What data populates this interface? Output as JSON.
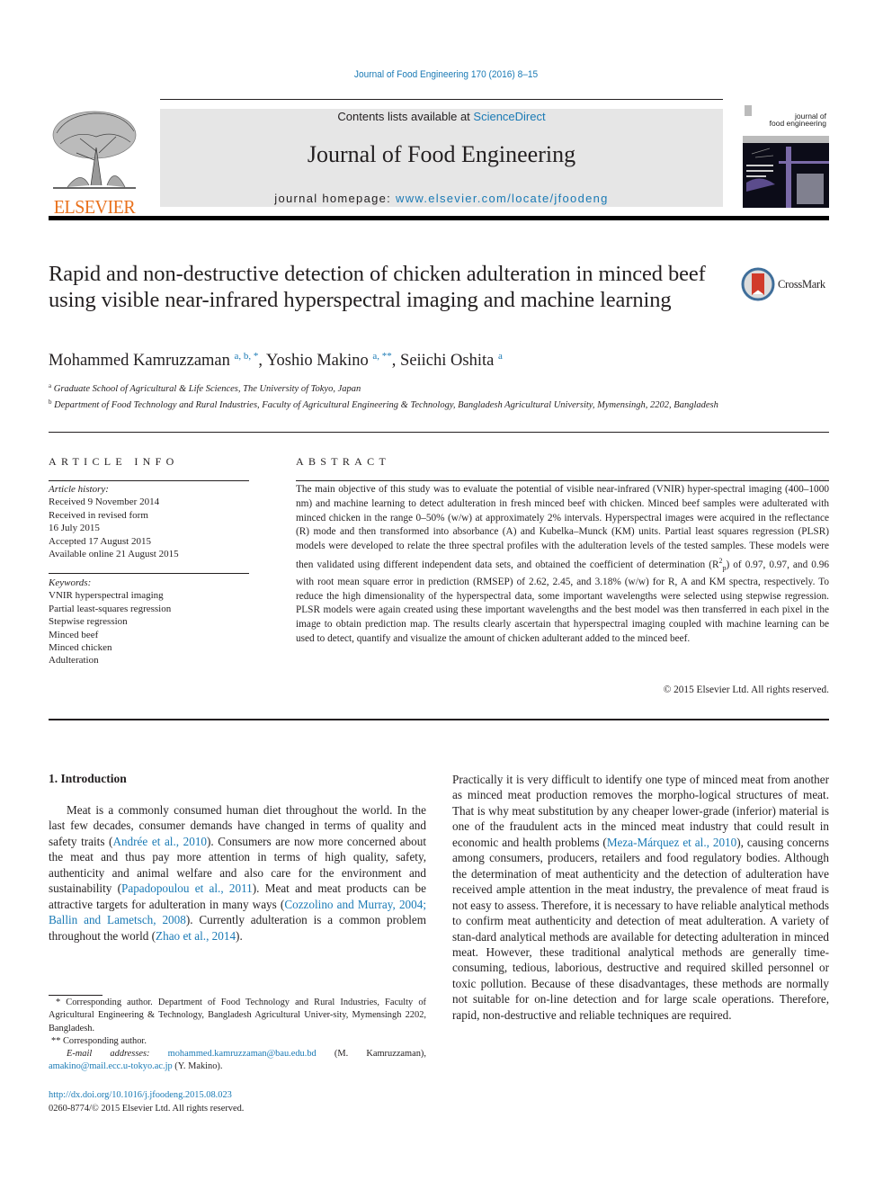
{
  "running_header": "Journal of Food Engineering 170 (2016) 8–15",
  "masthead": {
    "publisher": "ELSEVIER",
    "contents_prefix": "Contents lists available at ",
    "contents_link": "ScienceDirect",
    "journal_title": "Journal of Food Engineering",
    "homepage_prefix": "journal homepage: ",
    "homepage_link": "www.elsevier.com/locate/jfoodeng",
    "cover_title_line1": "journal of",
    "cover_title_line2": "food engineering"
  },
  "article": {
    "title": "Rapid and non-destructive detection of chicken adulteration in minced beef using visible near-infrared hyperspectral imaging and machine learning",
    "crossmark_label": "CrossMark",
    "authors": [
      {
        "name": "Mohammed Kamruzzaman",
        "sup": "a, b, *",
        "sep": ", "
      },
      {
        "name": "Yoshio Makino",
        "sup": "a, **",
        "sep": ", "
      },
      {
        "name": "Seiichi Oshita",
        "sup": "a",
        "sep": ""
      }
    ],
    "affiliations": [
      {
        "key": "a",
        "text": "Graduate School of Agricultural & Life Sciences, The University of Tokyo, Japan"
      },
      {
        "key": "b",
        "text": "Department of Food Technology and Rural Industries, Faculty of Agricultural Engineering & Technology, Bangladesh Agricultural University, Mymensingh, 2202, Bangladesh"
      }
    ]
  },
  "article_info": {
    "heading": "ARTICLE INFO",
    "history_label": "Article history:",
    "history": [
      "Received 9 November 2014",
      "Received in revised form",
      "16 July 2015",
      "Accepted 17 August 2015",
      "Available online 21 August 2015"
    ],
    "keywords_label": "Keywords:",
    "keywords": [
      "VNIR hyperspectral imaging",
      "Partial least-squares regression",
      "Stepwise regression",
      "Minced beef",
      "Minced chicken",
      "Adulteration"
    ]
  },
  "abstract": {
    "heading": "ABSTRACT",
    "text_part1": "The main objective of this study was to evaluate the potential of visible near-infrared (VNIR) hyper-spectral imaging (400–1000 nm) and machine learning to detect adulteration in fresh minced beef with chicken. Minced beef samples were adulterated with minced chicken in the range 0–50% (w/w) at approximately 2% intervals. Hyperspectral images were acquired in the reflectance (R) mode and then transformed into absorbance (A) and Kubelka–Munck (KM) units. Partial least squares regression (PLSR) models were developed to relate the three spectral profiles with the adulteration levels of the tested samples. These models were then validated using different independent data sets, and obtained the coefficient of determination (R",
    "sup": "2",
    "sub": "p",
    "text_part2": ") of 0.97, 0.97, and 0.96 with root mean square error in prediction (RMSEP) of 2.62, 2.45, and 3.18% (w/w) for R, A and KM spectra, respectively. To reduce the high dimensionality of the hyperspectral data, some important wavelengths were selected using stepwise regression. PLSR models were again created using these important wavelengths and the best model was then transferred in each pixel in the image to obtain prediction map. The results clearly ascertain that hyperspectral imaging coupled with machine learning can be used to detect, quantify and visualize the amount of chicken adulterant added to the minced beef.",
    "copyright": "© 2015 Elsevier Ltd. All rights reserved."
  },
  "body": {
    "section_heading": "1.  Introduction",
    "left_paragraph": [
      {
        "t": "Meat is a commonly consumed human diet throughout the world. In the last few decades, consumer demands have changed in terms of quality and safety traits ("
      },
      {
        "link": "Andrée et al., 2010"
      },
      {
        "t": "). Consumers are now more concerned about the meat and thus pay more attention in terms of high quality, safety, authenticity and animal welfare and also care for the environment and sustainability ("
      },
      {
        "link": "Papadopoulou et al., 2011"
      },
      {
        "t": "). Meat and meat products can be attractive targets for adulteration in many ways ("
      },
      {
        "link": "Cozzolino and Murray, 2004; Ballin and Lametsch, 2008"
      },
      {
        "t": "). Currently adulteration is a common problem throughout the world ("
      },
      {
        "link": "Zhao et al., 2014"
      },
      {
        "t": ")."
      }
    ],
    "right_paragraph": [
      {
        "t": "Practically it is very difficult to identify one type of minced meat from another as minced meat production removes the morpho-logical structures of meat. That is why meat substitution by any cheaper lower-grade (inferior) material is one of the fraudulent acts in the minced meat industry that could result in economic and health problems ("
      },
      {
        "link": "Meza-Márquez et al., 2010"
      },
      {
        "t": "), causing concerns among consumers, producers, retailers and food regulatory bodies. Although the determination of meat authenticity and the detection of adulteration have received ample attention in the meat industry, the prevalence of meat fraud is not easy to assess. Therefore, it is necessary to have reliable analytical methods to confirm meat authenticity and detection of meat adulteration. A variety of stan-dard analytical methods are available for detecting adulteration in minced meat. However, these traditional analytical methods are generally time-consuming, tedious, laborious, destructive and required skilled personnel or toxic pollution. Because of these disadvantages, these methods are normally not suitable for on-line detection and for large scale operations. Therefore, rapid, non-destructive and reliable techniques are required."
      }
    ]
  },
  "footnotes": {
    "corr1": "* Corresponding author. Department of Food Technology and Rural Industries, Faculty of Agricultural Engineering & Technology, Bangladesh Agricultural Univer-sity, Mymensingh 2202, Bangladesh.",
    "corr2": "** Corresponding author.",
    "email_label": "E-mail addresses: ",
    "email1": "mohammed.kamruzzaman@bau.edu.bd",
    "email1_owner": " (M. Kamruzzaman), ",
    "email2": "amakino@mail.ecc.u-tokyo.ac.jp",
    "email2_owner": " (Y. Makino).",
    "doi": "http://dx.doi.org/10.1016/j.jfoodeng.2015.08.023",
    "issn": "0260-8774/© 2015 Elsevier Ltd. All rights reserved."
  },
  "colors": {
    "link": "#1a7ab5",
    "elsevier_orange": "#e9711c",
    "masthead_gray": "#e6e6e6"
  }
}
